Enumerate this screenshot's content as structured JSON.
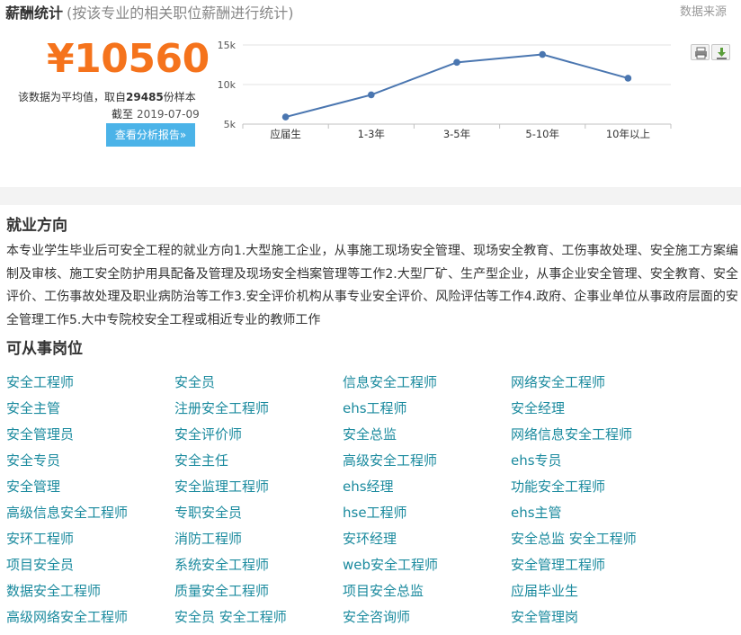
{
  "header": {
    "title": "薪酬统计",
    "subtitle": "(按该专业的相关职位薪酬进行统计)",
    "source_link": "数据来源"
  },
  "salary": {
    "amount": "¥10560",
    "note_prefix": "该数据为平均值，取自",
    "sample_count": "29485",
    "note_suffix": "份样本",
    "as_of_label": "截至",
    "as_of_date": "2019-07-09",
    "report_button": "查看分析报告»"
  },
  "chart_data": {
    "type": "line",
    "categories": [
      "应届生",
      "1-3年",
      "3-5年",
      "5-10年",
      "10年以上"
    ],
    "values": [
      5900,
      8700,
      12800,
      13800,
      10800
    ],
    "y_ticks": [
      "5k",
      "10k",
      "15k"
    ],
    "ylim": [
      5000,
      15000
    ],
    "grid": true,
    "line_color": "#4a76b0"
  },
  "toolbar": {
    "icons": [
      "print-icon",
      "download-icon"
    ]
  },
  "career": {
    "title": "就业方向",
    "body": "本专业学生毕业后可安全工程的就业方向1.大型施工企业，从事施工现场安全管理、现场安全教育、工伤事故处理、安全施工方案编制及审核、施工安全防护用具配备及管理及现场安全档案管理等工作2.大型厂矿、生产型企业，从事企业安全管理、安全教育、安全评价、工伤事故处理及职业病防治等工作3.安全评价机构从事专业安全评价、风险评估等工作4.政府、企事业单位从事政府层面的安全管理工作5.大中专院校安全工程或相近专业的教师工作"
  },
  "positions": {
    "title": "可从事岗位",
    "rows": [
      [
        "安全工程师",
        "安全员",
        "信息安全工程师",
        "网络安全工程师"
      ],
      [
        "安全主管",
        "注册安全工程师",
        "ehs工程师",
        "安全经理"
      ],
      [
        "安全管理员",
        "安全评价师",
        "安全总监",
        "网络信息安全工程师"
      ],
      [
        "安全专员",
        "安全主任",
        "高级安全工程师",
        "ehs专员"
      ],
      [
        "安全管理",
        "安全监理工程师",
        "ehs经理",
        "功能安全工程师"
      ],
      [
        "高级信息安全工程师",
        "专职安全员",
        "hse工程师",
        "ehs主管"
      ],
      [
        "安环工程师",
        "消防工程师",
        "安环经理",
        "安全总监 安全工程师"
      ],
      [
        "项目安全员",
        "系统安全工程师",
        "web安全工程师",
        "安全管理工程师"
      ],
      [
        "数据安全工程师",
        "质量安全工程师",
        "项目安全总监",
        "应届毕业生"
      ],
      [
        "高级网络安全工程师",
        "安全员 安全工程师",
        "安全咨询师",
        "安全管理岗"
      ]
    ]
  }
}
